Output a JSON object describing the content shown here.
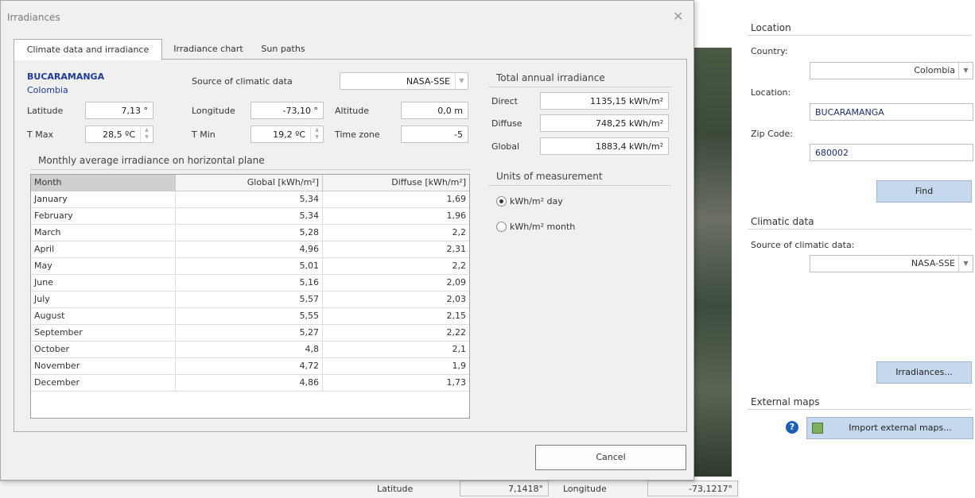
{
  "dialog": {
    "title": "Irradiances",
    "close_icon": "close-icon",
    "tabs": [
      {
        "label": "Climate data and irradiance",
        "active": true
      },
      {
        "label": "Irradiance chart",
        "active": false
      },
      {
        "label": "Sun paths",
        "active": false
      }
    ],
    "city": "BUCARAMANGA",
    "country": "Colombia",
    "latitude_label": "Latitude",
    "latitude_value": "7,13 °",
    "longitude_label": "Longitude",
    "longitude_value": "-73,10 °",
    "altitude_label": "Altitude",
    "altitude_value": "0,0 m",
    "tmax_label": "T Max",
    "tmax_value": "28,5 ºC",
    "tmin_label": "T Min",
    "tmin_value": "19,2 ºC",
    "timezone_label": "Time zone",
    "timezone_value": "-5",
    "source_label": "Source of climatic data",
    "source_value": "NASA-SSE",
    "table_title": "Monthly average irradiance on horizontal plane",
    "table_headers": [
      "Month",
      "Global [kWh/m²]",
      "Diffuse [kWh/m²]"
    ],
    "table_rows": [
      [
        "January",
        "5,34",
        "1,69"
      ],
      [
        "February",
        "5,34",
        "1,96"
      ],
      [
        "March",
        "5,28",
        "2,2"
      ],
      [
        "April",
        "4,96",
        "2,31"
      ],
      [
        "May",
        "5,01",
        "2,2"
      ],
      [
        "June",
        "5,16",
        "2,09"
      ],
      [
        "July",
        "5,57",
        "2,03"
      ],
      [
        "August",
        "5,55",
        "2,15"
      ],
      [
        "September",
        "5,27",
        "2,22"
      ],
      [
        "October",
        "4,8",
        "2,1"
      ],
      [
        "November",
        "4,72",
        "1,9"
      ],
      [
        "December",
        "4,86",
        "1,73"
      ]
    ],
    "total_title": "Total annual irradiance",
    "direct_label": "Direct",
    "direct_value": "1135,15 kWh/m²",
    "diffuse_label": "Diffuse",
    "diffuse_value": "748,25 kWh/m²",
    "global_label": "Global",
    "global_value": "1883,4 kWh/m²",
    "units_title": "Units of measurement",
    "units_options": [
      {
        "label": "kWh/m² day",
        "selected": true
      },
      {
        "label": "kWh/m² month",
        "selected": false
      }
    ],
    "cancel_label": "Cancel"
  },
  "status_bar": {
    "latitude_label": "Latitude",
    "latitude_value": "7,1418°",
    "longitude_label": "Longitude",
    "longitude_value": "-73,1217°"
  },
  "right_panel": {
    "location_title": "Location",
    "country_label": "Country:",
    "country_value": "Colombia",
    "location_label": "Location:",
    "location_value": "BUCARAMANGA",
    "zip_label": "Zip Code:",
    "zip_value": "680002",
    "find_label": "Find",
    "climatic_title": "Climatic data",
    "source_label": "Source of climatic data:",
    "source_value": "NASA-SSE",
    "irradiances_label": "Irradiances...",
    "external_title": "External maps",
    "import_label": "Import external maps...",
    "help_icon": "help-icon",
    "map_icon": "map-icon"
  },
  "colors": {
    "accent_blue_text": "#1e3a9a",
    "button_blue": "#c6d8ee",
    "help_blue": "#1c5fb5"
  }
}
